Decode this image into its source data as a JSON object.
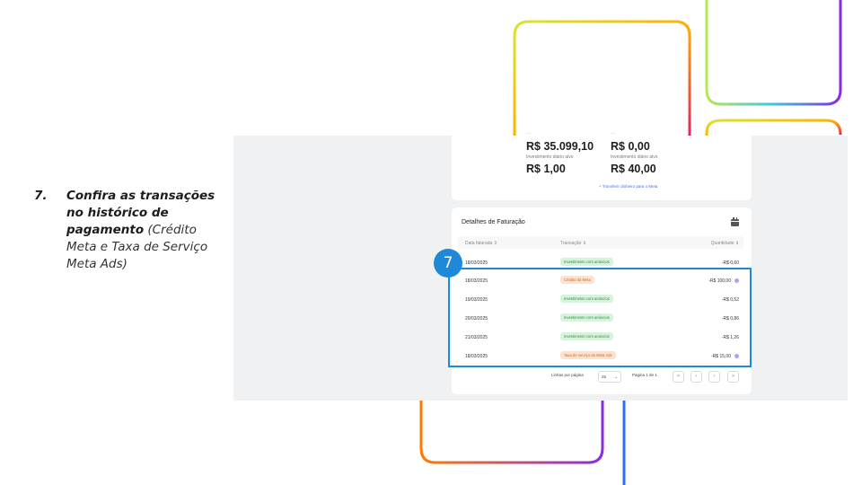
{
  "instruction": {
    "number": "7.",
    "bold_text": "Confira as transações no histórico de pagamento",
    "normal_text": "(Crédito Meta e Taxa de Serviço Meta Ads)"
  },
  "summary": {
    "top_left_value": "R$ 35.099,10",
    "top_right_value": "R$ 0,00",
    "daily_left_label": "Investimento diário alvo",
    "daily_left_value": "R$ 1,00",
    "daily_right_label": "Investimento diário alvo",
    "daily_right_value": "R$ 40,00",
    "transfer_link": "+ Transferir dinheiro para o Meta"
  },
  "billing": {
    "title": "Detalhes de Faturação",
    "columns": {
      "date": "Data faturada  ⇕",
      "transaction": "Transação  ⇕",
      "amount": "Quantidade  ⇕"
    },
    "rows": [
      {
        "date": "18/03/2025",
        "transaction": "Investimento com anúncios",
        "type": "green",
        "amount": "-R$ 0,60"
      },
      {
        "date": "18/03/2025",
        "transaction": "Crédito da Meta",
        "type": "orange",
        "amount": "-R$ 100,00"
      },
      {
        "date": "19/03/2025",
        "transaction": "Investimento com anúncios",
        "type": "green",
        "amount": "-R$ 0,52"
      },
      {
        "date": "20/03/2025",
        "transaction": "Investimento com anúncios",
        "type": "green",
        "amount": "-R$ 0,86"
      },
      {
        "date": "21/03/2025",
        "transaction": "Investimento com anúncios",
        "type": "green",
        "amount": "-R$ 1,26"
      },
      {
        "date": "18/03/2025",
        "transaction": "Taxa de serviço da Meta Ads",
        "type": "orange",
        "amount": "-R$ 15,00"
      }
    ],
    "pagination": {
      "rows_per_page_label": "Linhas por página",
      "rows_per_page_value": "25",
      "page_label": "Página 1 de 1"
    }
  },
  "step_badge": "7",
  "colors": {
    "accent": "#1e88d9",
    "green_badge": "#d7f3dc",
    "orange_badge": "#fde3cf"
  }
}
